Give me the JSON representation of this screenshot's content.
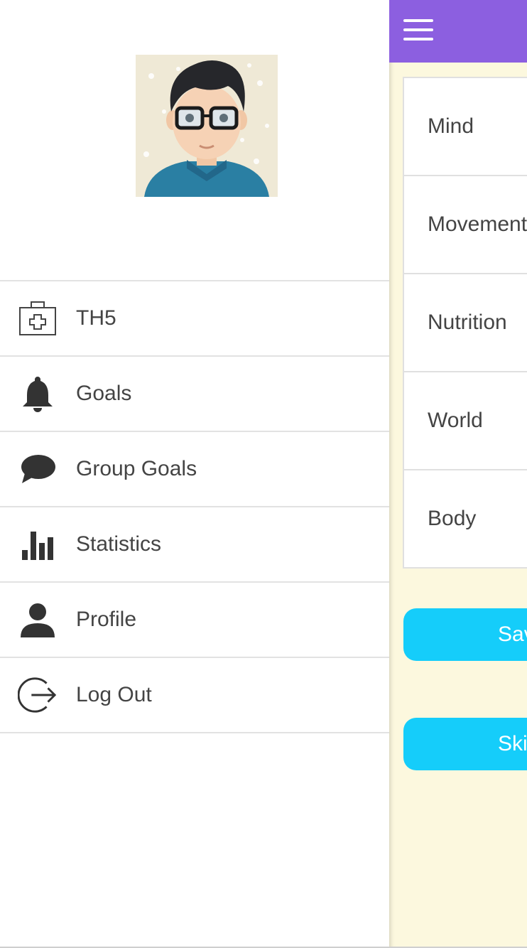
{
  "drawer": {
    "items": [
      {
        "label": "TH5",
        "icon": "medical-kit-icon"
      },
      {
        "label": "Goals",
        "icon": "bell-icon"
      },
      {
        "label": "Group Goals",
        "icon": "chat-bubble-icon"
      },
      {
        "label": "Statistics",
        "icon": "bar-chart-icon"
      },
      {
        "label": "Profile",
        "icon": "person-icon"
      },
      {
        "label": "Log Out",
        "icon": "logout-icon"
      }
    ]
  },
  "main": {
    "categories": [
      "Mind",
      "Movement",
      "Nutrition",
      "World",
      "Body"
    ],
    "save_label": "Save",
    "skip_label": "Skip"
  },
  "colors": {
    "header": "#8c5fe0",
    "button": "#15cdfa",
    "background": "#fcf8de"
  }
}
